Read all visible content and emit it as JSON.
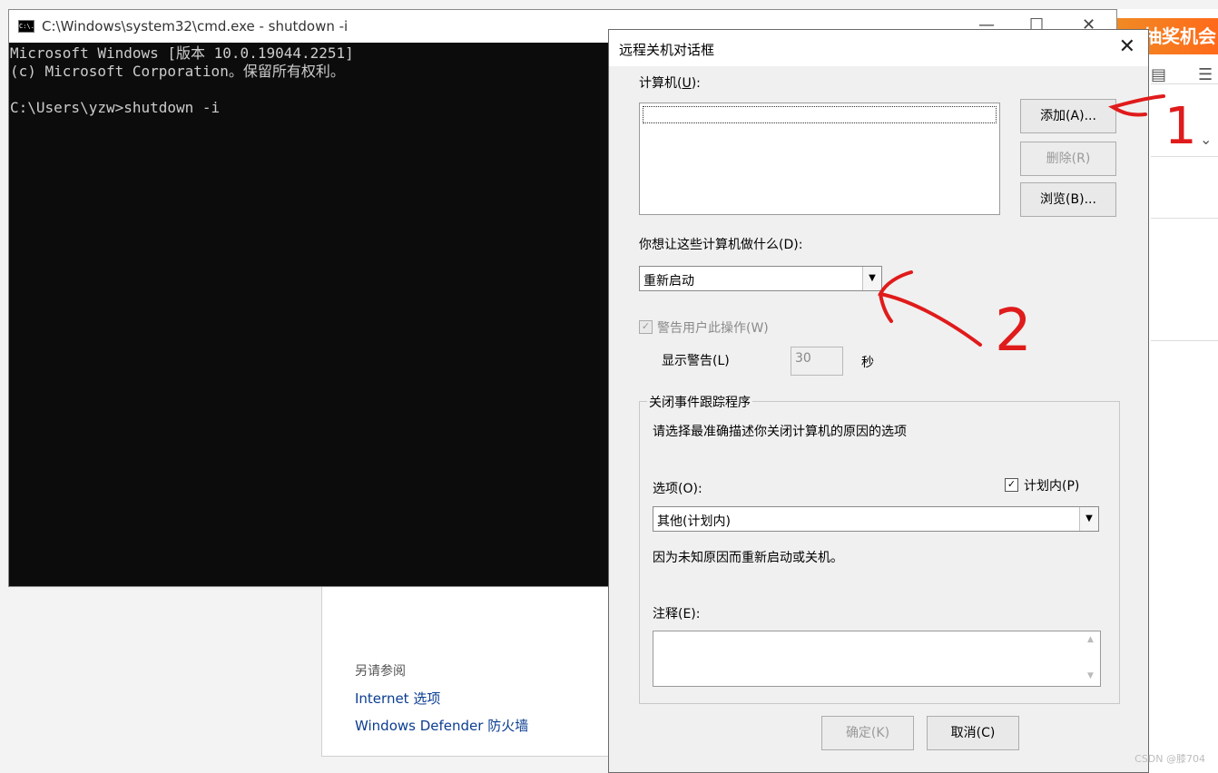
{
  "cmd": {
    "title": "C:\\Windows\\system32\\cmd.exe - shutdown  -i",
    "icon_label": "C:\\.",
    "lines": [
      "Microsoft Windows [版本 10.0.19044.2251]",
      "(c) Microsoft Corporation。保留所有权利。",
      "",
      "C:\\Users\\yzw>shutdown -i"
    ],
    "controls": {
      "minimize": "—",
      "maximize": "☐",
      "close": "✕"
    }
  },
  "background_window": {
    "see_also": "另请参阅",
    "links": [
      "Internet 选项",
      "Windows Defender 防火墙"
    ]
  },
  "browser_edge": {
    "banner": "抽奖机会，"
  },
  "dialog": {
    "title": "远程关机对话框",
    "close": "✕",
    "computers_label": "计算机(",
    "computers_key": "U",
    "computers_label_end": "):",
    "buttons": {
      "add": "添加(A)...",
      "delete": "删除(R)",
      "browse": "浏览(B)...",
      "ok": "确定(K)",
      "cancel": "取消(C)"
    },
    "action_label": "你想让这些计算机做什么(D):",
    "action_value": "重新启动",
    "warn_checkbox": "警告用户此操作(W)",
    "warn_checked": true,
    "show_warning_label": "显示警告(L)",
    "warning_seconds": "30",
    "seconds_unit": "秒",
    "tracker": {
      "group_title": "关闭事件跟踪程序",
      "description": "请选择最准确描述你关闭计算机的原因的选项",
      "option_label": "选项(O):",
      "planned_label": "计划内(P)",
      "planned_checked": true,
      "option_value": "其他(计划内)",
      "reason_text": "因为未知原因而重新启动或关机。",
      "comment_label": "注释(E):"
    }
  },
  "annotations": {
    "one": "1",
    "two": "2"
  },
  "watermark": "CSDN @膝704"
}
